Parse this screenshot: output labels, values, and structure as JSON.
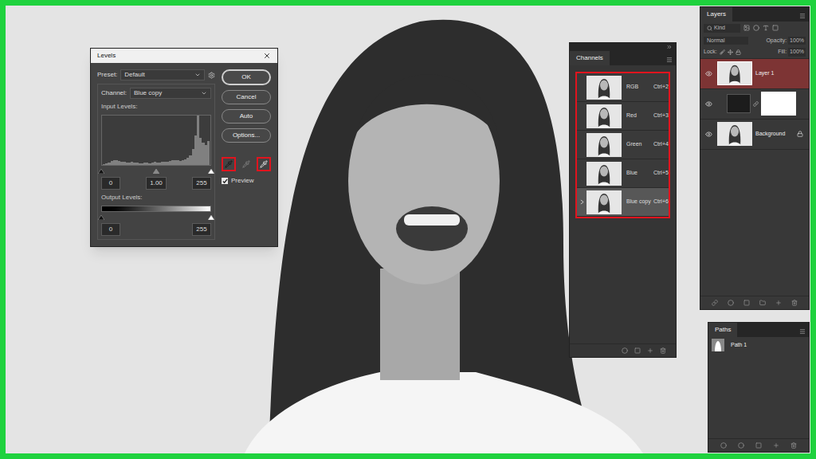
{
  "levels_dialog": {
    "title": "Levels",
    "preset": {
      "label": "Preset:",
      "value": "Default"
    },
    "channel": {
      "label": "Channel:",
      "value": "Blue copy"
    },
    "input_levels": {
      "label": "Input Levels:",
      "black": "0",
      "gamma": "1.00",
      "white": "255",
      "black_level": 0,
      "gamma_level": 0.5,
      "white_level": 1
    },
    "histogram": {
      "values": [
        2,
        3,
        5,
        8,
        10,
        9,
        8,
        7,
        6,
        5,
        5,
        6,
        5,
        5,
        4,
        4,
        5,
        5,
        4,
        5,
        6,
        5,
        5,
        6,
        6,
        7,
        8,
        9,
        10,
        9,
        8,
        9,
        11,
        14,
        20,
        32,
        60,
        100,
        55,
        45,
        40,
        48
      ]
    },
    "output_levels": {
      "label": "Output Levels:",
      "black": "0",
      "white": "255",
      "black_level": 0,
      "white_level": 1
    },
    "buttons": [
      {
        "label": "OK",
        "default": true
      },
      {
        "label": "Cancel",
        "default": false
      },
      {
        "label": "Auto",
        "default": false
      },
      {
        "label": "Options...",
        "default": false
      }
    ],
    "eyedroppers": [
      {
        "kind": "black",
        "highlighted": true
      },
      {
        "kind": "gray",
        "highlighted": false
      },
      {
        "kind": "white",
        "highlighted": true
      }
    ],
    "preview": {
      "label": "Preview",
      "checked": true
    }
  },
  "channels": {
    "title": "Channels",
    "highlighted": true,
    "rows": [
      {
        "name": "RGB",
        "shortcut": "Ctrl+2",
        "selected": false,
        "visible": false
      },
      {
        "name": "Red",
        "shortcut": "Ctrl+3",
        "selected": false,
        "visible": false
      },
      {
        "name": "Green",
        "shortcut": "Ctrl+4",
        "selected": false,
        "visible": false
      },
      {
        "name": "Blue",
        "shortcut": "Ctrl+5",
        "selected": false,
        "visible": false
      },
      {
        "name": "Blue copy",
        "shortcut": "Ctrl+6",
        "selected": true,
        "visible": true
      }
    ]
  },
  "layers": {
    "title": "Layers",
    "filter": "Kind",
    "blend_mode": "Normal",
    "opacity": {
      "label": "Opacity:",
      "value": "100%"
    },
    "lock_label": "Lock:",
    "fill": {
      "label": "Fill:",
      "value": "100%"
    },
    "rows": [
      {
        "name": "Layer 1",
        "kind": "pixel",
        "selected": true,
        "visible": true,
        "locked": false
      },
      {
        "name": "",
        "kind": "adjustment",
        "selected": false,
        "visible": true,
        "locked": false
      },
      {
        "name": "Background",
        "kind": "pixel",
        "selected": false,
        "visible": true,
        "locked": true
      }
    ]
  },
  "paths": {
    "title": "Paths",
    "rows": [
      {
        "name": "Path 1",
        "selected": false
      }
    ]
  }
}
